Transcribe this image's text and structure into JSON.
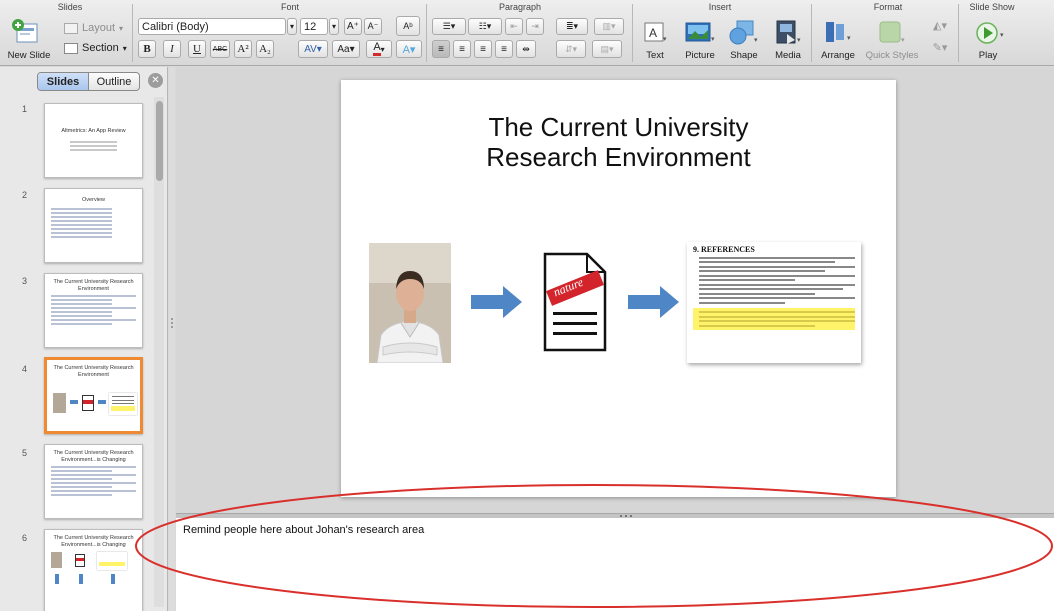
{
  "ribbon": {
    "groups": {
      "slides": "Slides",
      "font": "Font",
      "paragraph": "Paragraph",
      "insert": "Insert",
      "format": "Format",
      "slide_show": "Slide Show"
    },
    "new_slide": "New Slide",
    "layout": "Layout",
    "section": "Section",
    "font_name": "Calibri (Body)",
    "font_size": "12",
    "bold": "B",
    "italic": "I",
    "underline": "U",
    "strikethrough": "ABC",
    "superscript": "A²",
    "subscript": "A₂",
    "insert_text": "Text",
    "insert_picture": "Picture",
    "insert_shape": "Shape",
    "insert_media": "Media",
    "arrange": "Arrange",
    "quick_styles": "Quick Styles",
    "play": "Play"
  },
  "left_pane": {
    "tabs": [
      "Slides",
      "Outline"
    ],
    "active_tab": "Slides",
    "thumbnails": [
      {
        "number": "1",
        "title": "Altmetrics: An App Review"
      },
      {
        "number": "2",
        "title": "Overview"
      },
      {
        "number": "3",
        "title": "The Current University Research Environment"
      },
      {
        "number": "4",
        "title": "The Current University Research Environment",
        "selected": true
      },
      {
        "number": "5",
        "title": "The Current University Research Environment...is Changing"
      },
      {
        "number": "6",
        "title": "The Current University Research Environment...is Changing"
      }
    ]
  },
  "slide": {
    "title_line1": "The Current University",
    "title_line2": "Research Environment",
    "doc_stamp": "nature",
    "refs_heading": "9.  REFERENCES"
  },
  "notes": {
    "text": "Remind people here about Johan's research area"
  },
  "colors": {
    "accent_selected": "#f08a32",
    "annotation_oval": "#d9302c",
    "arrow": "#4f86c6"
  }
}
